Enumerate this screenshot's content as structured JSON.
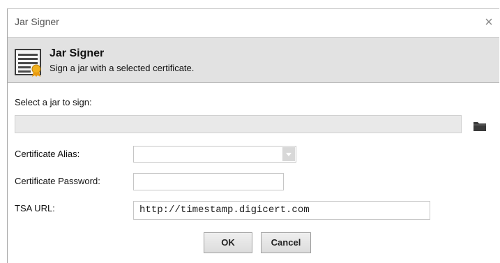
{
  "window": {
    "title": "Jar Signer",
    "close_glyph": "×"
  },
  "header": {
    "title": "Jar Signer",
    "subtitle": "Sign a jar with a selected certificate.",
    "icon": "certificate-document-icon"
  },
  "form": {
    "jar_label": "Select a jar to sign:",
    "jar_value": "",
    "browse_icon": "folder-icon",
    "alias_label": "Certificate Alias:",
    "alias_value": "",
    "password_label": "Certificate Password:",
    "password_value": "",
    "tsa_label": "TSA URL:",
    "tsa_value": "http://timestamp.digicert.com"
  },
  "buttons": {
    "ok_label": "OK",
    "cancel_label": "Cancel"
  }
}
